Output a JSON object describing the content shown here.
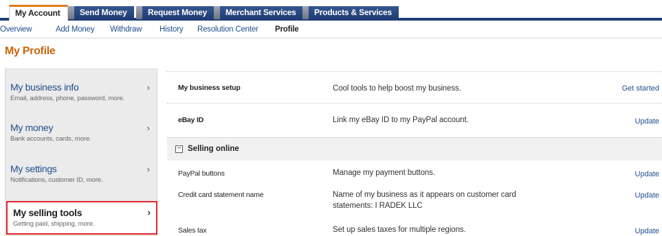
{
  "tabs": [
    {
      "label": "My Account",
      "active": true
    },
    {
      "label": "Send Money",
      "active": false
    },
    {
      "label": "Request Money",
      "active": false
    },
    {
      "label": "Merchant Services",
      "active": false
    },
    {
      "label": "Products & Services",
      "active": false
    }
  ],
  "subnav": [
    "Overview",
    "Add Money",
    "Withdraw",
    "History",
    "Resolution Center",
    "Profile"
  ],
  "subnav_current": "Profile",
  "page_title": "My Profile",
  "sidebar": {
    "items": [
      {
        "title": "My business info",
        "desc": "Email, address, phone, password, more.",
        "chevron": "›"
      },
      {
        "title": "My money",
        "desc": "Bank accounts, cards, more.",
        "chevron": "›"
      },
      {
        "title": "My settings",
        "desc": "Notifications, customer ID, more.",
        "chevron": "›"
      },
      {
        "title": "My selling tools",
        "desc": "Getting paid, shipping, more.",
        "chevron": "›"
      }
    ]
  },
  "content": {
    "rows": [
      {
        "key": "My business setup",
        "desc": "Cool tools to help boost my business.",
        "action": "Get started"
      },
      {
        "key": "eBay ID",
        "desc": "Link my eBay ID to my PayPal account.",
        "action": "Update"
      }
    ],
    "section": {
      "toggle": "−",
      "label": "Selling online"
    },
    "section_rows": [
      {
        "key": "PayPal buttons",
        "desc": "Manage my payment buttons.",
        "action": "Update"
      },
      {
        "key": "Credit card statement name",
        "desc": "Name of my business as it appears on customer card statements: I RADEK LLC",
        "action": "Update"
      },
      {
        "key": "Sales tax",
        "desc": "Set up sales taxes for multiple regions.",
        "action": "Update"
      }
    ]
  },
  "colors": {
    "nav": "#1f3c74",
    "title": "#c8650a",
    "link": "#1f4e8c",
    "highlight": "#e0242b"
  }
}
